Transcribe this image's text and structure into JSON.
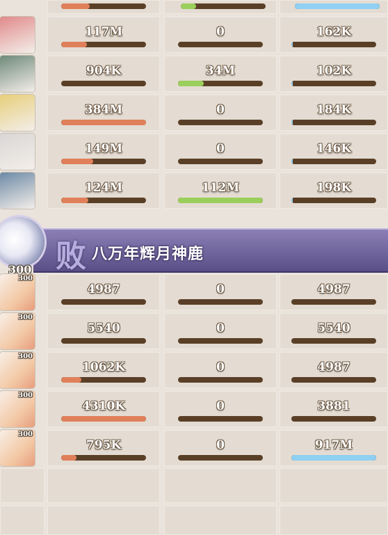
{
  "colors": {
    "damage": "#e0805a",
    "heal": "#9bcf5c",
    "taken": "#8fd0f3",
    "bar_bg": "#5a3f27"
  },
  "allies": [
    {
      "portrait": "red-hair-portrait",
      "damage": "117M",
      "damage_ratio": 0.3,
      "heal": "0",
      "heal_ratio": 0,
      "taken": "162K",
      "taken_ratio": 0.02
    },
    {
      "portrait": "dark-hair-portrait",
      "damage": "904K",
      "damage_ratio": 0,
      "heal": "34M",
      "heal_ratio": 0.3,
      "taken": "102K",
      "taken_ratio": 0.02
    },
    {
      "portrait": "blonde-portrait",
      "damage": "384M",
      "damage_ratio": 1.0,
      "heal": "0",
      "heal_ratio": 0,
      "taken": "184K",
      "taken_ratio": 0.02
    },
    {
      "portrait": "silver-hair-portrait",
      "damage": "149M",
      "damage_ratio": 0.38,
      "heal": "0",
      "heal_ratio": 0,
      "taken": "146K",
      "taken_ratio": 0.02
    },
    {
      "portrait": "teal-hair-portrait",
      "damage": "124M",
      "damage_ratio": 0.32,
      "heal": "112M",
      "heal_ratio": 1.0,
      "taken": "198K",
      "taken_ratio": 0.02
    }
  ],
  "banner": {
    "result": "败",
    "enemy_name": "八万年辉月神鹿",
    "level": "300"
  },
  "enemies": [
    {
      "portrait": "white-deer-portrait",
      "level": "300",
      "damage": "4987",
      "damage_ratio": 0,
      "heal": "0",
      "heal_ratio": 0,
      "taken": "4987",
      "taken_ratio": 0
    },
    {
      "portrait": "white-deer-portrait",
      "level": "300",
      "damage": "5540",
      "damage_ratio": 0,
      "heal": "0",
      "heal_ratio": 0,
      "taken": "5540",
      "taken_ratio": 0
    },
    {
      "portrait": "white-deer-portrait",
      "level": "300",
      "damage": "1062K",
      "damage_ratio": 0.24,
      "heal": "0",
      "heal_ratio": 0,
      "taken": "4987",
      "taken_ratio": 0
    },
    {
      "portrait": "white-deer-portrait",
      "level": "300",
      "damage": "4310K",
      "damage_ratio": 1.0,
      "heal": "0",
      "heal_ratio": 0,
      "taken": "3881",
      "taken_ratio": 0
    },
    {
      "portrait": "white-deer-portrait",
      "level": "300",
      "damage": "795K",
      "damage_ratio": 0.18,
      "heal": "0",
      "heal_ratio": 0,
      "taken": "917M",
      "taken_ratio": 1.0
    }
  ]
}
